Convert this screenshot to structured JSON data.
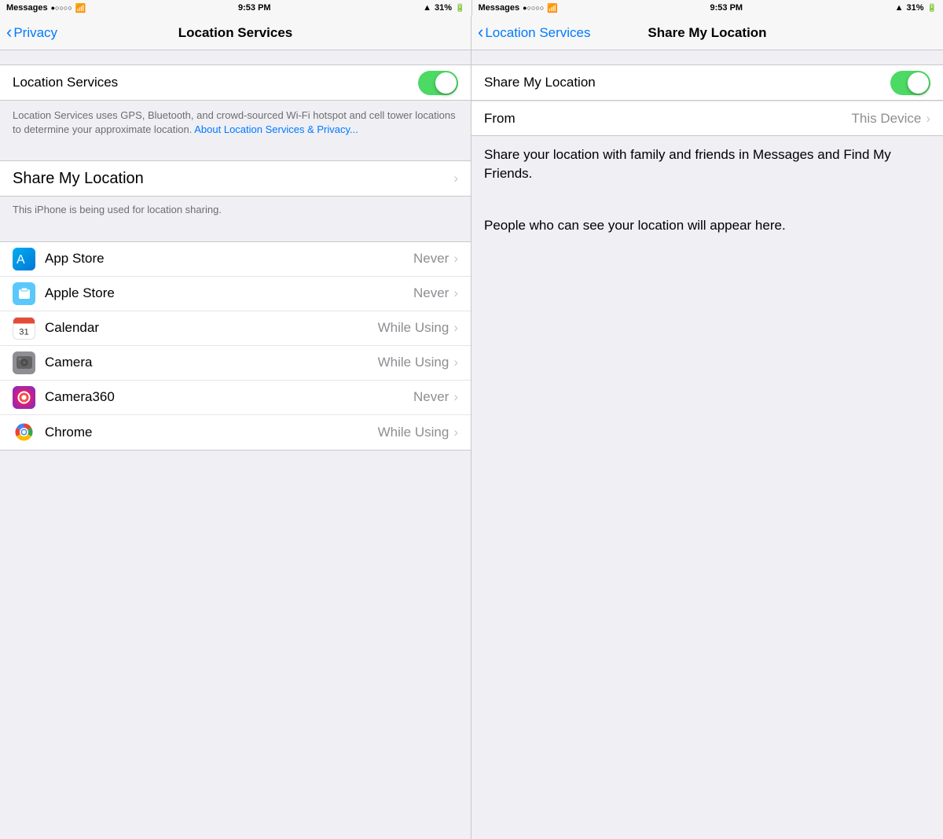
{
  "status": {
    "left": {
      "carrier": "Messages",
      "signal": "●○○○○",
      "wifi": "WiFi",
      "time": "9:53 PM",
      "lock": "🔒",
      "location": "▲",
      "battery_pct": "31%"
    },
    "right": {
      "carrier": "Messages",
      "signal": "●○○○○",
      "wifi": "WiFi",
      "time": "9:53 PM",
      "lock": "🔒",
      "location": "▲",
      "battery_pct": "31%"
    }
  },
  "left_panel": {
    "nav": {
      "back_label": "Privacy",
      "title": "Location Services"
    },
    "location_services": {
      "label": "Location Services",
      "toggle_on": true
    },
    "description": "Location Services uses GPS, Bluetooth, and crowd-sourced Wi-Fi hotspot and cell tower locations to determine your approximate location.",
    "link": "About Location Services & Privacy...",
    "share_my_location": {
      "label": "Share My Location",
      "chevron": "›"
    },
    "share_note": "This iPhone is being used for location sharing.",
    "apps": [
      {
        "name": "App Store",
        "permission": "Never",
        "icon_type": "appstore"
      },
      {
        "name": "Apple Store",
        "permission": "Never",
        "icon_type": "applestore"
      },
      {
        "name": "Calendar",
        "permission": "While Using",
        "icon_type": "calendar"
      },
      {
        "name": "Camera",
        "permission": "While Using",
        "icon_type": "camera"
      },
      {
        "name": "Camera360",
        "permission": "Never",
        "icon_type": "camera360"
      },
      {
        "name": "Chrome",
        "permission": "While Using",
        "icon_type": "chrome"
      }
    ]
  },
  "right_panel": {
    "nav": {
      "back_label": "Location Services",
      "title": "Share My Location"
    },
    "share_my_location": {
      "label": "Share My Location",
      "toggle_on": true
    },
    "from": {
      "label": "From",
      "value": "This Device",
      "chevron": "›"
    },
    "description": "Share your location with family and friends in Messages and Find My Friends.",
    "people_note": "People who can see your location will appear here."
  }
}
